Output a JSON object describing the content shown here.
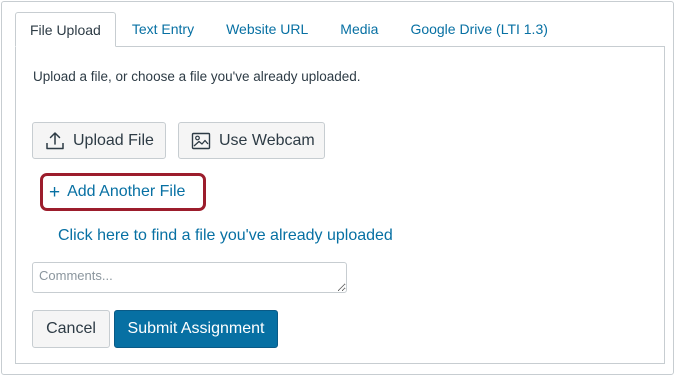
{
  "tabs": [
    {
      "label": "File Upload",
      "active": true
    },
    {
      "label": "Text Entry",
      "active": false
    },
    {
      "label": "Website URL",
      "active": false
    },
    {
      "label": "Media",
      "active": false
    },
    {
      "label": "Google Drive (LTI 1.3)",
      "active": false
    }
  ],
  "upload": {
    "instructions": "Upload a file, or choose a file you've already uploaded.",
    "upload_file_label": "Upload File",
    "use_webcam_label": "Use Webcam",
    "add_another_file_label": "Add Another File",
    "find_file_link": "Click here to find a file you've already uploaded"
  },
  "comments": {
    "placeholder": "Comments...",
    "value": ""
  },
  "actions": {
    "cancel_label": "Cancel",
    "submit_label": "Submit Assignment"
  },
  "colors": {
    "link": "#0770a3",
    "primary_button": "#0770a3",
    "highlight_border": "#9c1d2c",
    "text": "#2d3b45",
    "border": "#c7cdd1"
  },
  "icons": {
    "upload_file": "upload-icon",
    "use_webcam": "webcam-icon",
    "add_another_file": "plus-icon"
  }
}
